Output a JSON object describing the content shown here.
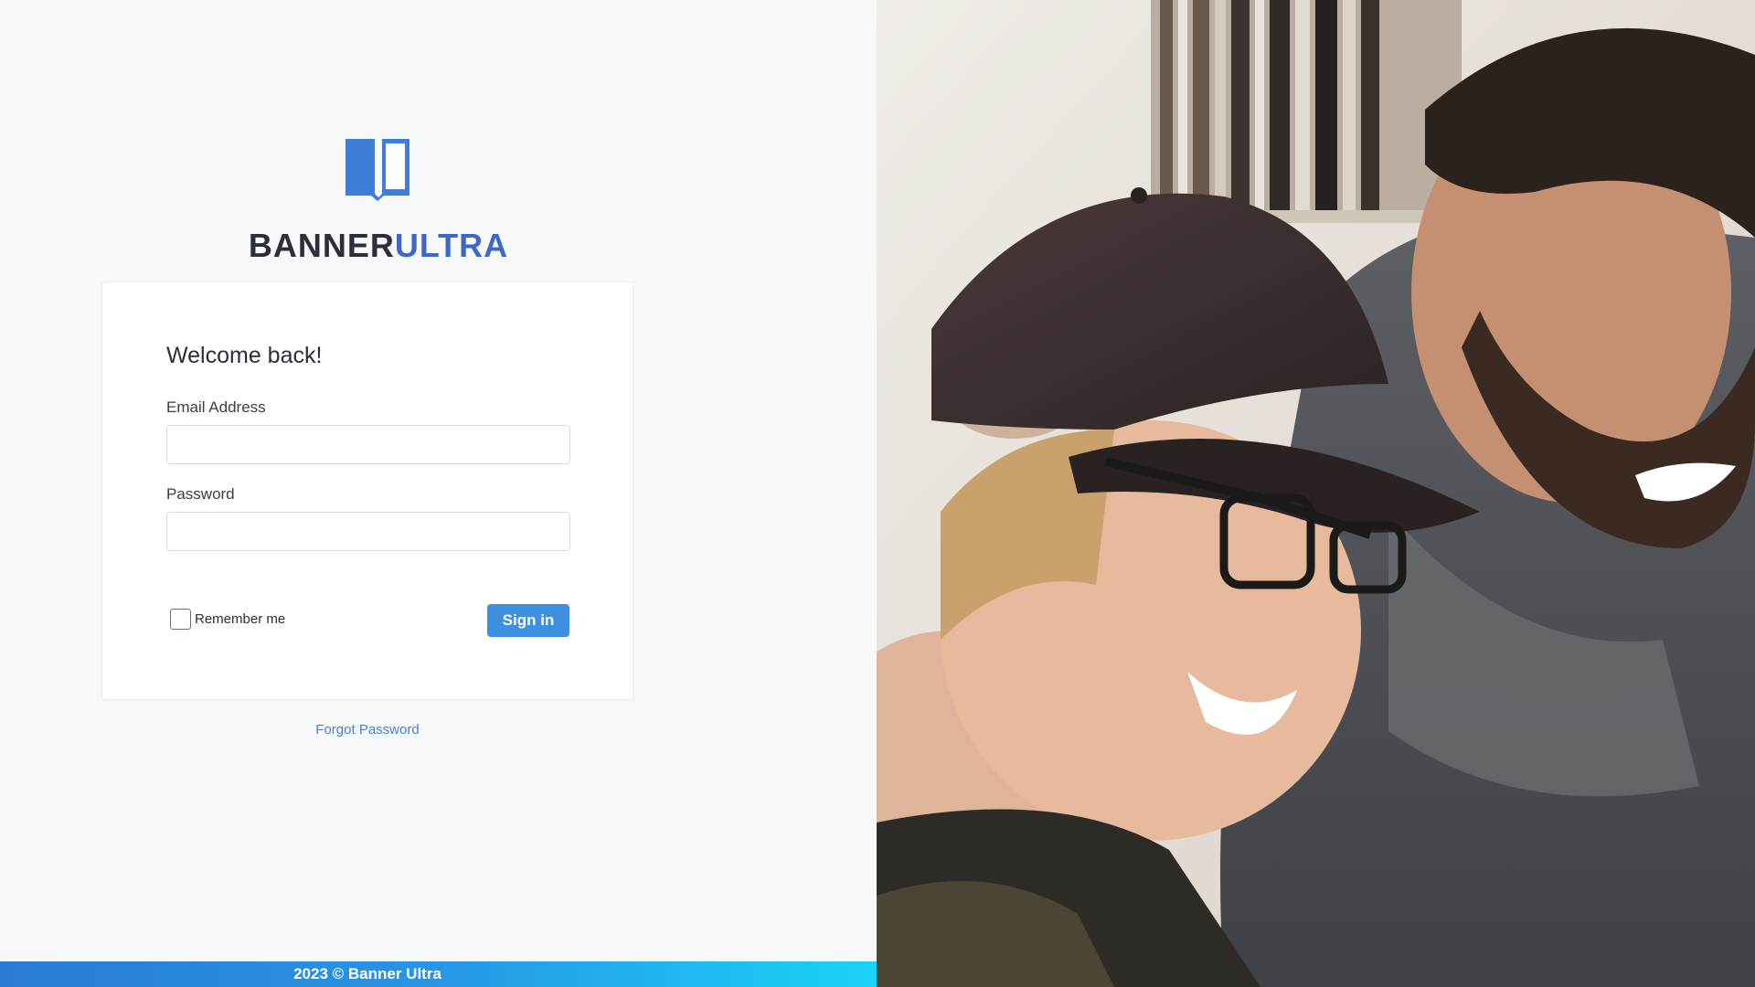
{
  "brand": {
    "name_part1": "BANNER",
    "name_part2": "ULTRA",
    "logo_icon": "open-book-icon",
    "accent_color": "#3f68c4"
  },
  "login_card": {
    "heading": "Welcome back!",
    "email_label": "Email Address",
    "email_value": "",
    "password_label": "Password",
    "password_value": "",
    "remember_label": "Remember me",
    "remember_checked": false,
    "signin_label": "Sign in"
  },
  "links": {
    "forgot_password": "Forgot Password"
  },
  "footer": {
    "text": "2023 © Banner Ultra"
  },
  "colors": {
    "primary_button": "#3d8fe0",
    "footer_gradient_start": "#2a7bd3",
    "footer_gradient_end": "#19d3f6"
  }
}
